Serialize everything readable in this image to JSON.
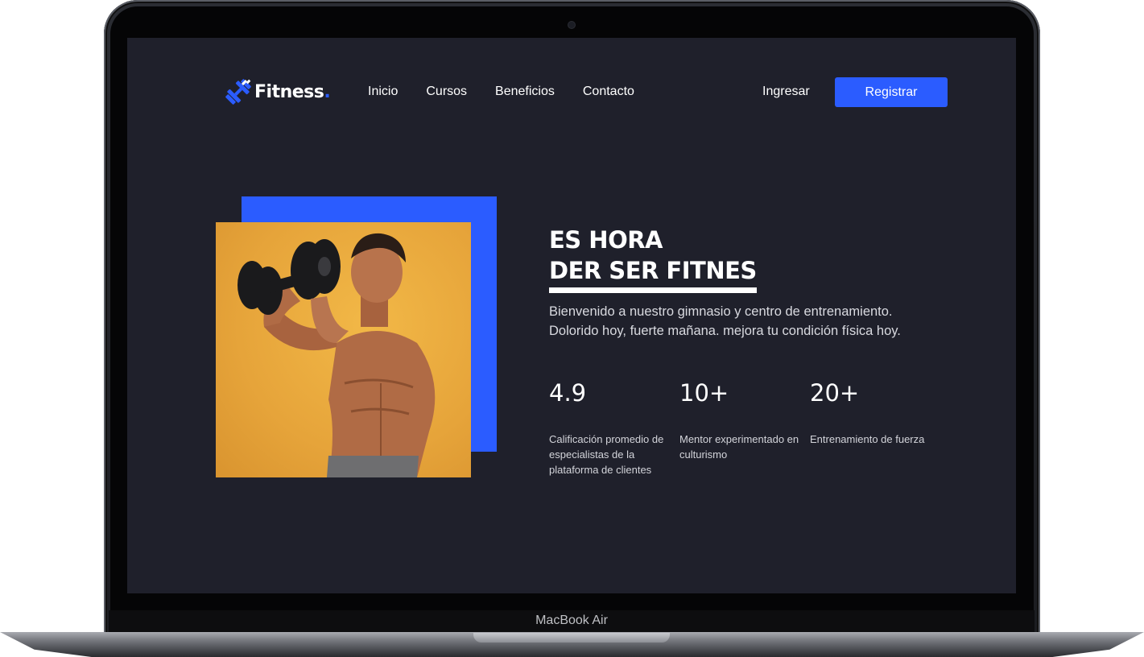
{
  "device": {
    "model": "MacBook Air"
  },
  "site": {
    "logo_text": "Fitness",
    "logo_dot": ".",
    "nav": [
      "Inicio",
      "Cursos",
      "Beneficios",
      "Contacto"
    ],
    "login_label": "Ingresar",
    "register_label": "Registrar",
    "accent_color": "#2b5cff",
    "background_color": "#1f202b"
  },
  "hero": {
    "headline_line1": "ES HORA",
    "headline_line2": "DER SER FITNES",
    "intro_line1": "Bienvenido a nuestro gimnasio y centro de entrenamiento.",
    "intro_line2": "Dolorido hoy, fuerte mañana. mejora tu condición física hoy.",
    "stats": [
      {
        "value": "4.9",
        "label": "Calificación promedio de especialistas de la plataforma de clientes"
      },
      {
        "value": "10+",
        "label": "Mentor experimentado en culturismo"
      },
      {
        "value": "20+",
        "label": "Entrenamiento de fuerza"
      }
    ]
  }
}
